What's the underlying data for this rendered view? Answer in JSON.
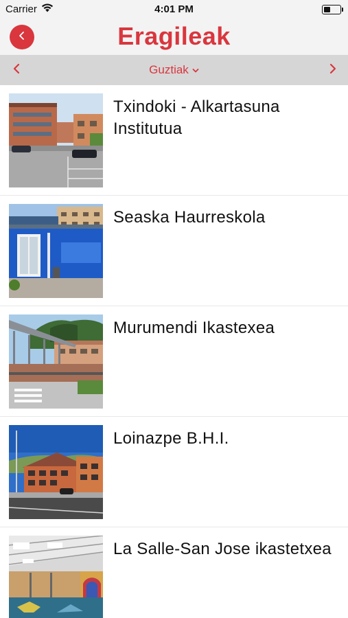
{
  "status": {
    "carrier": "Carrier",
    "time": "4:01 PM",
    "battery_level": 0.45
  },
  "header": {
    "title": "Eragileak",
    "back_icon": "chevron-left-icon"
  },
  "filter": {
    "selected": "Guztiak",
    "prev_icon": "chevron-left-icon",
    "next_icon": "chevron-right-icon"
  },
  "items": [
    {
      "title": "Txindoki - Alkartasuna Institutua"
    },
    {
      "title": "Seaska Haurreskola"
    },
    {
      "title": "Murumendi Ikastexea"
    },
    {
      "title": "Loinazpe B.H.I."
    },
    {
      "title": "La Salle-San Jose ikastetxea"
    }
  ],
  "colors": {
    "accent": "#d9363e",
    "filter_bg": "#d6d6d6",
    "header_bg": "#f3f3f3"
  }
}
